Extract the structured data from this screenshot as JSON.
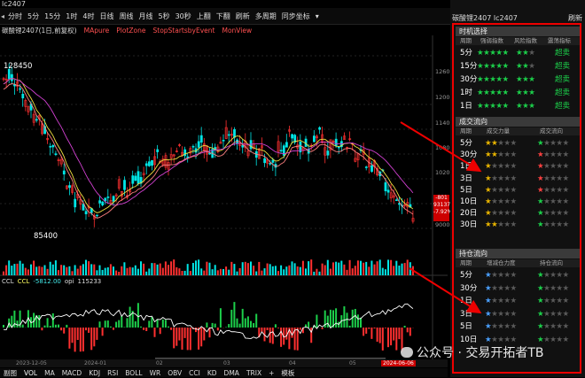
{
  "window": {
    "code": "lc2407"
  },
  "toolbar": {
    "items": [
      "分时",
      "5分",
      "15分",
      "1时",
      "4时",
      "日线",
      "周线",
      "月线",
      "5秒",
      "30秒",
      "上翻",
      "下翻",
      "刷新",
      "多周期",
      "同步坐标"
    ]
  },
  "legend": {
    "code": "碳酸锂2407(1日,前复权)",
    "indicators": [
      "MApure",
      "PlotZone",
      "StopStartsbyEvent",
      "MonView"
    ]
  },
  "chart_labels": {
    "high": "128450",
    "low": "85400"
  },
  "y_axis": [
    "126000",
    "120000",
    "114000",
    "108000",
    "102000",
    "96000",
    "90000"
  ],
  "current_price": {
    "l1": "-801",
    "l2": "93137",
    "l3": "-7.92%"
  },
  "indicator2": {
    "name": "CCL",
    "v1": "CCL",
    "v2": "-5812.00",
    "v3": "opi",
    "v4": "115233"
  },
  "dates": {
    "d1": "2023-12-05",
    "d2": "2024-01",
    "d3": "02",
    "d4": "03",
    "d5": "04",
    "d6": "05",
    "d7": "2024-06-06"
  },
  "tabs": [
    "副图",
    "VOL",
    "MA",
    "MACD",
    "KDJ",
    "RSI",
    "BOLL",
    "WR",
    "OBV",
    "CCI",
    "KD",
    "DMA",
    "TRIX",
    "+",
    "模板"
  ],
  "panel": {
    "title": "碳酸锂2407 lc2407",
    "refresh": "刷新",
    "timing": {
      "header": "时机选择",
      "cols": [
        "周期",
        "强弱指数",
        "风险指数",
        "震荡指标"
      ],
      "rows": [
        {
          "period": "5分",
          "tag": "超卖"
        },
        {
          "period": "15分",
          "tag": "超卖"
        },
        {
          "period": "30分",
          "tag": "超卖"
        },
        {
          "period": "1时",
          "tag": "超卖"
        },
        {
          "period": "1日",
          "tag": "超卖"
        }
      ]
    },
    "flow": {
      "header": "成交流向",
      "cols": [
        "周期",
        "成交力量",
        "成交流向"
      ],
      "rows": [
        "5分",
        "30分",
        "1日",
        "3日",
        "5日",
        "10日",
        "20日",
        "30日"
      ]
    },
    "hold": {
      "header": "持仓流向",
      "cols": [
        "周期",
        "增减仓力度",
        "持仓流向"
      ],
      "rows": [
        "5分",
        "30分",
        "1日",
        "3日",
        "5日",
        "10日"
      ]
    }
  },
  "watermark": {
    "text": "公众号 · 交易开拓者TB"
  },
  "colors": {
    "up": "#ff3030",
    "down": "#00e5e5",
    "accent": "#e00000",
    "green": "#1ccf4a"
  }
}
